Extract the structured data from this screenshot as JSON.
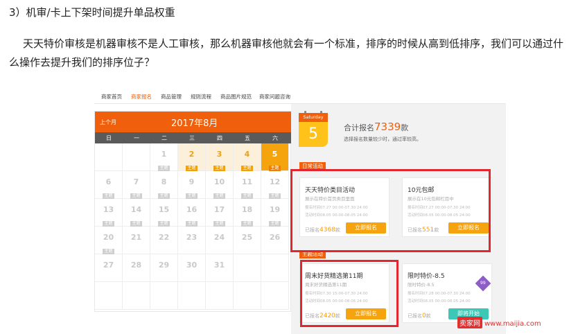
{
  "heading": "3）机审/卡上下架时间提升单品权重",
  "paragraph": "天天特价审核是机器审核不是人工审核，那么机器审核他就会有一个标准，排序的时候从高到低排序，我们可以通过什么操作去提升我们的排序位子？",
  "nav": [
    "商家首页",
    "商家报名",
    "商品管理",
    "规则流程",
    "商品图片规范",
    "商家问题咨询"
  ],
  "calendar": {
    "prev": "上个月",
    "title": "2017年8月",
    "weekdays": [
      "日",
      "一",
      "二",
      "三",
      "四",
      "五",
      "六"
    ],
    "tag": "主题",
    "days": [
      "1",
      "2",
      "3",
      "4",
      "5",
      "6",
      "7",
      "8",
      "9",
      "10",
      "11",
      "12",
      "13",
      "14",
      "15",
      "16",
      "17",
      "18",
      "19",
      "20",
      "21",
      "22",
      "23",
      "24",
      "25",
      "26",
      "27",
      "28",
      "29",
      "30",
      "31"
    ]
  },
  "datecard": {
    "weekday": "Saturday",
    "day": "5"
  },
  "total": {
    "prefix": "合计报名",
    "count": "7339",
    "suffix": "款",
    "sub": "选择报名数量较少时，通过率较高。"
  },
  "sections": {
    "daily": "日常活动",
    "theme": "主题活动"
  },
  "cards": [
    {
      "title": "天天特价类目活动",
      "sub": "展示在特价首页类目里面",
      "d1": "报名时间07.27 00:00-07.30 24:00",
      "d2": "活动时间08.05 00:00-08.05 24:00",
      "prefix": "已报名",
      "count": "4368",
      "suffix": "款",
      "button": "立即报名"
    },
    {
      "title": "10元包邮",
      "sub": "展示在10元包邮栏目中",
      "d1": "报名时间07.27 00:00-07.30 24:00",
      "d2": "活动时间08.05 00:00-08.05 24:00",
      "prefix": "已报名",
      "count": "551",
      "suffix": "款",
      "button": "立即报名"
    },
    {
      "title": "周末好货精选第11期",
      "sub": "周末好货精选第11期",
      "d1": "报名时间07.30 15:00-07.30 24:00",
      "d2": "活动时间08.05 00:00-08.06 24:00",
      "prefix": "已报名",
      "count": "2420",
      "suffix": "款",
      "button": "立即报名"
    },
    {
      "title": "限时特价-8.5",
      "sub": "限时特价-8.5",
      "d1": "报名时间07.28 00:00-07.30 24:00",
      "d2": "活动时间08.05 00:00-08.05 24:00",
      "prefix": "已报名",
      "count": "0",
      "suffix": "款",
      "button": "即将开始",
      "badge": "99"
    }
  ],
  "watermark": {
    "logo": "卖家网",
    "url": "www.maijia.com"
  },
  "colors": {
    "accent": "#ef5f0c",
    "highlight": "#f6a40e",
    "redbox": "#e3262e"
  }
}
